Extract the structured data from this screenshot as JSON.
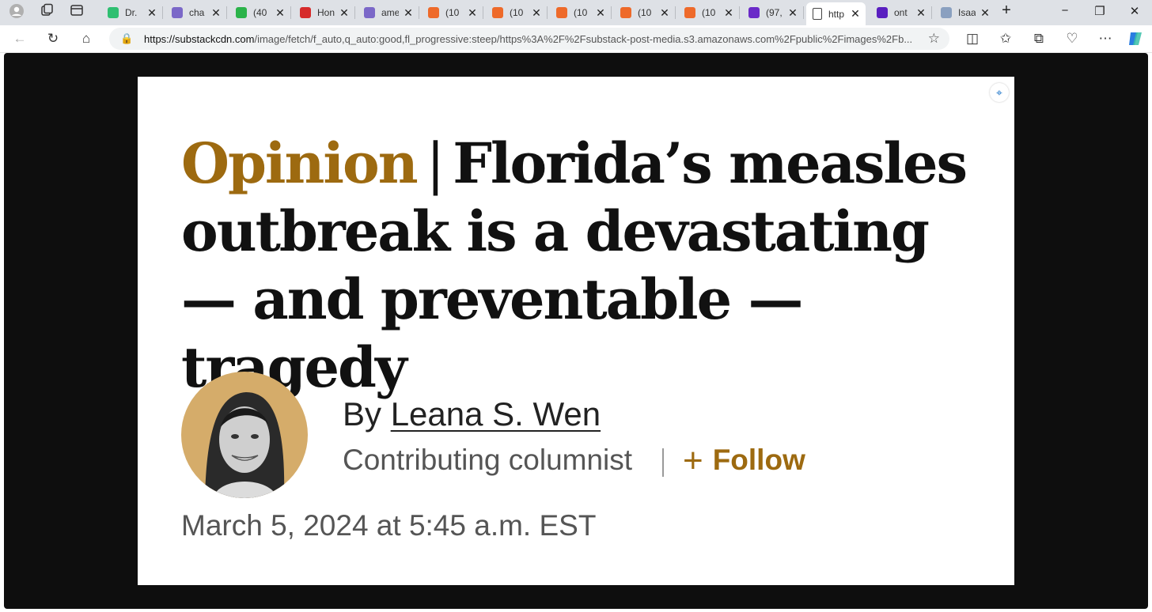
{
  "browser": {
    "tabs": [
      {
        "label": "Dr.",
        "favicon_color": "#2fbf71"
      },
      {
        "label": "cha",
        "favicon_color": "#7b68c8"
      },
      {
        "label": "(40",
        "favicon_color": "#2bb34a"
      },
      {
        "label": "Hon",
        "favicon_color": "#d62b2b"
      },
      {
        "label": "ame",
        "favicon_color": "#7b68c8"
      },
      {
        "label": "(10",
        "favicon_color": "#ee6a2a"
      },
      {
        "label": "(10",
        "favicon_color": "#ee6a2a"
      },
      {
        "label": "(10",
        "favicon_color": "#ee6a2a"
      },
      {
        "label": "(10",
        "favicon_color": "#ee6a2a"
      },
      {
        "label": "(10",
        "favicon_color": "#ee6a2a"
      },
      {
        "label": "(97,",
        "favicon_color": "#6a2ac8"
      },
      {
        "label": "http",
        "favicon_color": "#ffffff",
        "active": true
      },
      {
        "label": "ont",
        "favicon_color": "#5a1fc0"
      },
      {
        "label": "Isaa",
        "favicon_color": "#8aa0c0"
      }
    ],
    "url_domain": "https://substackcdn.com",
    "url_path": "/image/fetch/f_auto,q_auto:good,fl_progressive:steep/https%3A%2F%2Fsubstack-post-media.s3.amazonaws.com%2Fpublic%2Fimages%2Fb..."
  },
  "article": {
    "kicker": "Opinion",
    "separator": "|",
    "title": "Florida’s measles outbreak is a devastating — and preventable — tragedy",
    "by_prefix": "By",
    "author": "Leana S. Wen",
    "role": "Contributing columnist",
    "follow_label": "Follow",
    "follow_symbol": "+",
    "date": "March 5, 2024 at 5:45 a.m. EST"
  },
  "colors": {
    "accent": "#9d6a10",
    "headline": "#111111",
    "backdrop": "#0e0e0e"
  }
}
